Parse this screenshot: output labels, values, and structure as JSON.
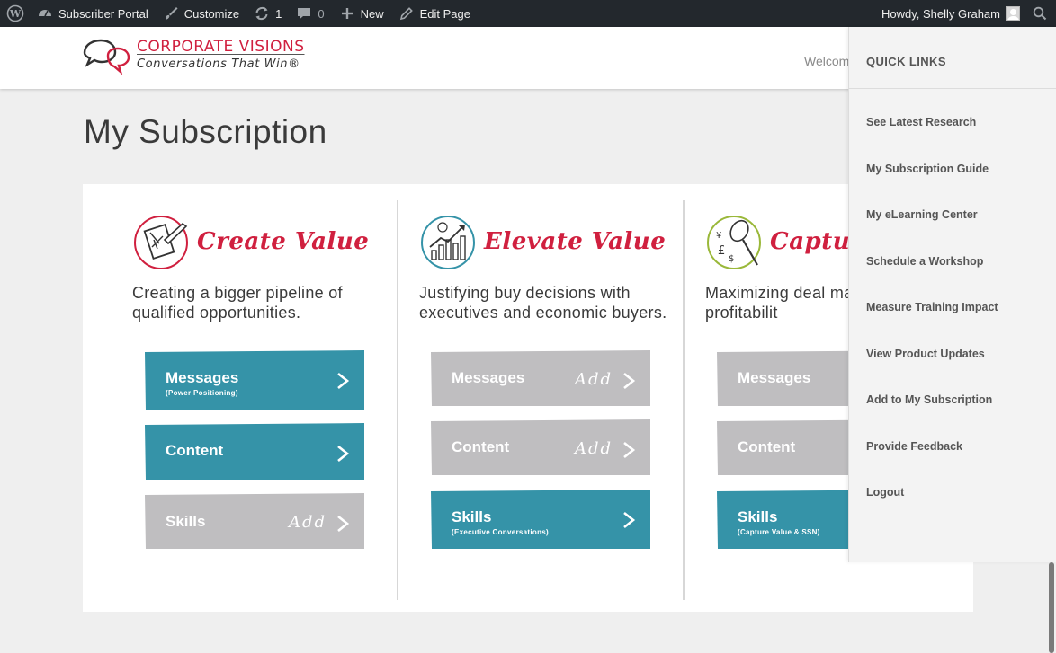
{
  "adminbar": {
    "site": "Subscriber Portal",
    "customize": "Customize",
    "updates_count": "1",
    "comments_count": "0",
    "new_label": "New",
    "edit_label": "Edit Page",
    "howdy": "Howdy, Shelly Graham",
    "icons": [
      "wordpress-icon",
      "dashboard-icon",
      "brush-icon",
      "refresh-icon",
      "comment-icon",
      "plus-icon",
      "pencil-icon",
      "avatar",
      "search-icon"
    ]
  },
  "header": {
    "logo_top": "CORPORATE VISIONS",
    "logo_bottom": "Conversations That Win®",
    "welcome": "Welcom"
  },
  "page": {
    "title": "My Subscription"
  },
  "columns": [
    {
      "title": "Create Value",
      "description": "Creating a bigger pipeline of qualified opportunities.",
      "icon": "checklist-icon",
      "buttons": [
        {
          "label": "Messages",
          "sub": "(Power Positioning)",
          "state": "active"
        },
        {
          "label": "Content",
          "sub": "",
          "state": "active"
        },
        {
          "label": "Skills",
          "sub": "",
          "state": "add",
          "add": "Add"
        }
      ]
    },
    {
      "title": "Elevate Value",
      "description": "Justifying buy decisions with executives and economic buyers.",
      "icon": "growth-chart-icon",
      "buttons": [
        {
          "label": "Messages",
          "sub": "",
          "state": "add",
          "add": "Add"
        },
        {
          "label": "Content",
          "sub": "",
          "state": "add",
          "add": "Add"
        },
        {
          "label": "Skills",
          "sub": "(Executive Conversations)",
          "state": "active"
        }
      ]
    },
    {
      "title": "Captur",
      "description": "Maximizing deal ma customer profitabilit",
      "icon": "money-net-icon",
      "buttons": [
        {
          "label": "Messages",
          "sub": "",
          "state": "add"
        },
        {
          "label": "Content",
          "sub": "",
          "state": "add"
        },
        {
          "label": "Skills",
          "sub": "(Capture Value & SSN)",
          "state": "active"
        }
      ]
    }
  ],
  "quick_links": {
    "heading": "QUICK LINKS",
    "items": [
      "See Latest Research",
      "My Subscription Guide",
      "My eLearning Center",
      "Schedule a Workshop",
      "Measure Training Impact",
      "View Product Updates",
      "Add to My Subscription",
      "Provide Feedback",
      "Logout"
    ]
  },
  "colors": {
    "brand_red": "#d0203f",
    "teal": "#3593a8",
    "inactive_gray": "#bfbec0",
    "adminbar": "#23282d"
  }
}
